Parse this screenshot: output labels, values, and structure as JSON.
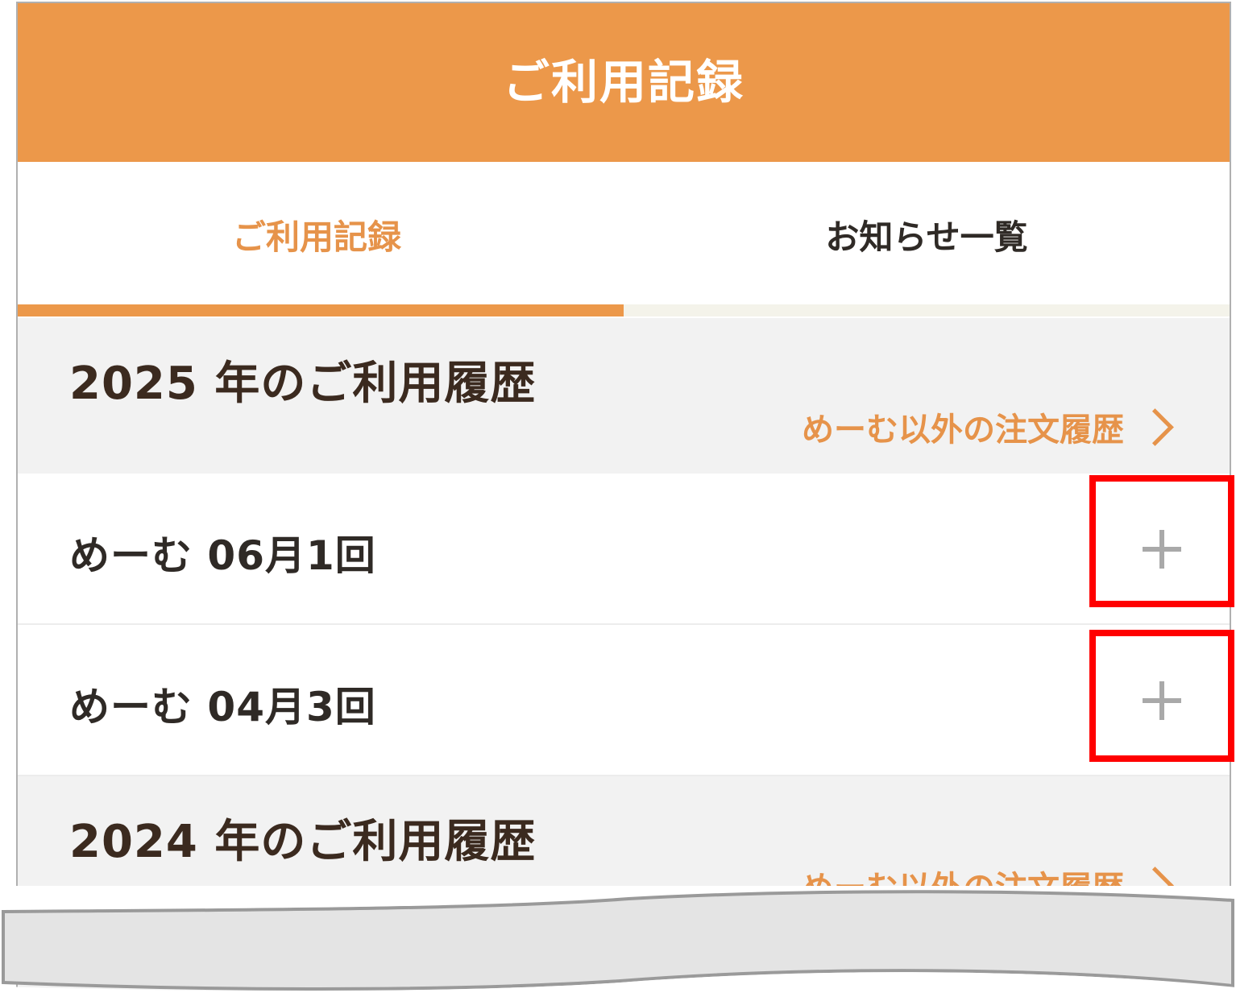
{
  "header": {
    "title": "ご利用記録"
  },
  "tabs": [
    {
      "label": "ご利用記録",
      "active": true
    },
    {
      "label": "お知らせ一覧",
      "active": false
    }
  ],
  "sections": [
    {
      "title": "2025 年のご利用履歴",
      "link_label": "めーむ以外の注文履歴",
      "rows": [
        {
          "label": "めーむ 06月1回",
          "expand_icon": "plus-icon"
        },
        {
          "label": "めーむ 04月3回",
          "expand_icon": "plus-icon"
        }
      ]
    },
    {
      "title": "2024 年のご利用履歴",
      "link_label": "めーむ以外の注文履歴",
      "rows": []
    }
  ],
  "colors": {
    "accent": "#ec984a",
    "accent_text": "#e6934a",
    "section_bg": "#f2f2f2",
    "highlight": "#ff0000",
    "icon_gray": "#a9a9a9"
  }
}
